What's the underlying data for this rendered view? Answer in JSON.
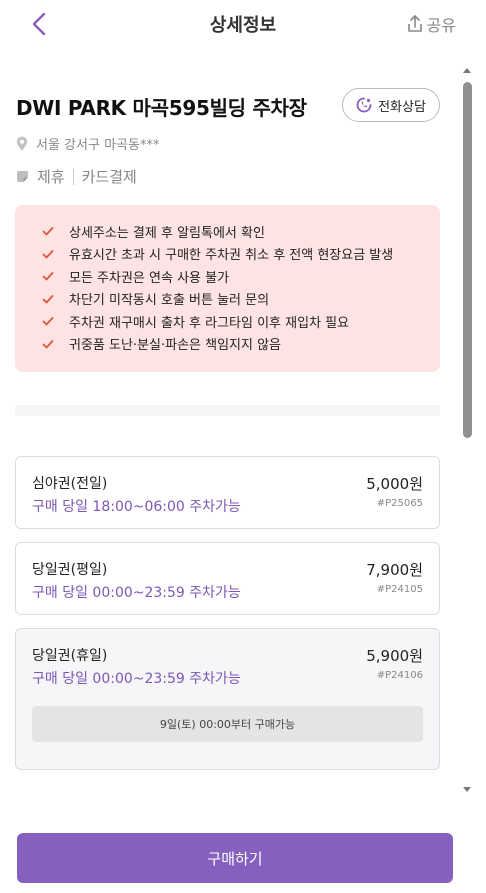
{
  "header": {
    "title": "상세정보",
    "share_label": "공유"
  },
  "parking": {
    "name": "DWI PARK 마곡595빌딩 주차장",
    "call_label": "전화상담",
    "address": "서울 강서구 마곡동***",
    "tags": [
      "제휴",
      "카드결제"
    ]
  },
  "notices": [
    "상세주소는 결제 후 알림톡에서 확인",
    "유효시간 초과 시 구매한 주차권 취소 후 전액 현장요금 발생",
    "모든 주차권은 연속 사용 불가",
    "차단기 미작동시 호출 버튼 눌러 문의",
    "주차권 재구매시 출차 후 라그타임 이후 재입차 필요",
    "귀중품 도난·분실·파손은 책임지지 않음"
  ],
  "tickets": [
    {
      "name": "심야권(전일)",
      "price": "5,000원",
      "time": "구매 당일 18:00~06:00 주차가능",
      "code": "#P25065"
    },
    {
      "name": "당일권(평일)",
      "price": "7,900원",
      "time": "구매 당일 00:00~23:59 주차가능",
      "code": "#P24105"
    },
    {
      "name": "당일권(휴일)",
      "price": "5,900원",
      "time": "구매 당일 00:00~23:59 주차가능",
      "code": "#P24106",
      "availability": "9일(토) 00:00부터 구매가능"
    }
  ],
  "buy_button": "구매하기",
  "colors": {
    "accent": "#8660bf",
    "notice_bg": "#fde3e1",
    "check": "#e0553f"
  },
  "icons": [
    "back-icon",
    "share-icon",
    "phone-icon",
    "location-pin-icon",
    "tag-icon",
    "check-icon"
  ]
}
